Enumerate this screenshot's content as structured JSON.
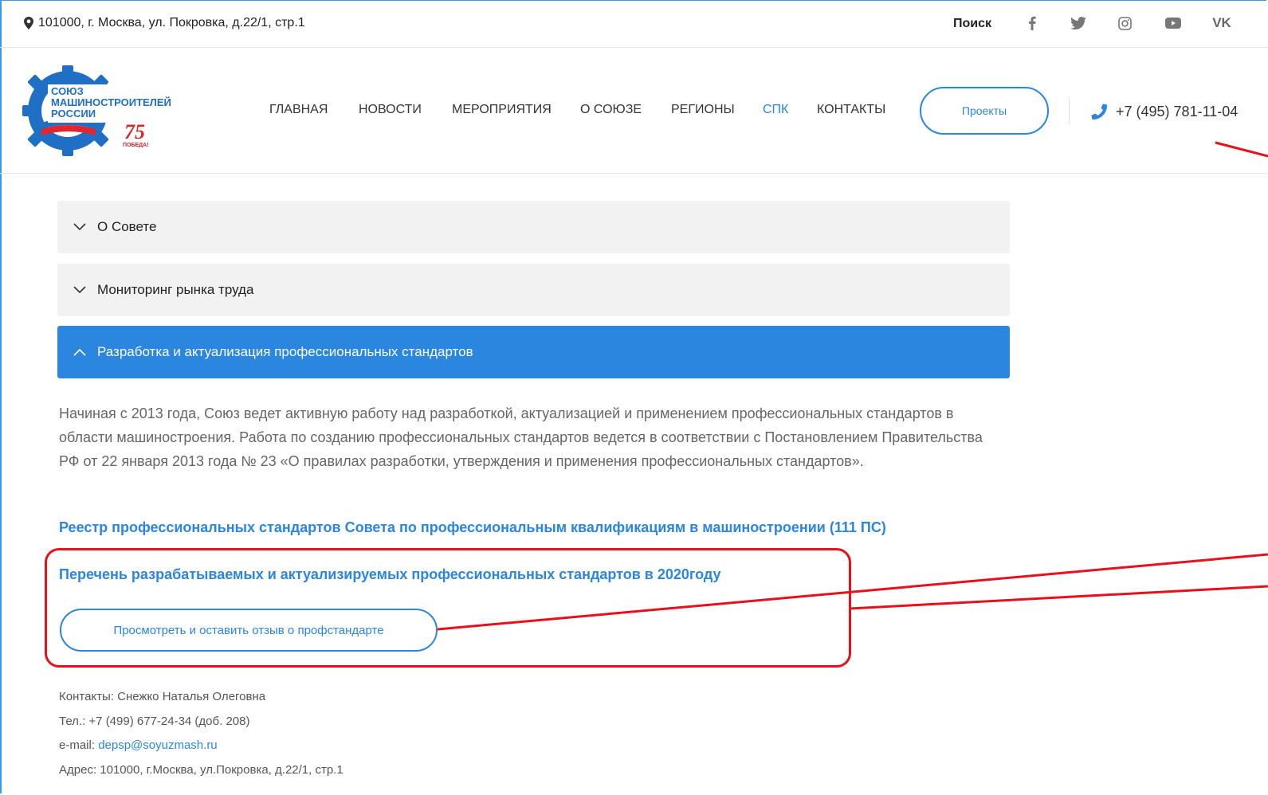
{
  "topbar": {
    "address": "101000, г. Москва, ул. Покровка, д.22/1, стр.1",
    "search": "Поиск",
    "social_icons": [
      "facebook-icon",
      "twitter-icon",
      "instagram-icon",
      "youtube-icon",
      "vk-icon"
    ],
    "vk_label": "VK"
  },
  "logo": {
    "line1": "СОЮЗ",
    "line2": "МАШИНОСТРОИТЕЛЕЙ",
    "line3": "РОССИИ",
    "badge_number": "75",
    "badge_word": "ПОБЕДА!"
  },
  "nav": {
    "items": [
      "ГЛАВНАЯ",
      "НОВОСТИ",
      "МЕРОПРИЯТИЯ",
      "О СОЮЗЕ",
      "РЕГИОНЫ",
      "СПК",
      "КОНТАКТЫ"
    ],
    "active": "СПК",
    "projects_button": "Проекты",
    "phone": "+7 (495) 781-11-04"
  },
  "accordion": [
    {
      "label": "О Совете",
      "open": false
    },
    {
      "label": "Мониторинг рынка труда",
      "open": false
    },
    {
      "label": "Разработка и актуализация профессиональных стандартов",
      "open": true
    }
  ],
  "content": {
    "paragraph": "Начиная с 2013 года, Союз ведет активную работу над разработкой, актуализацией и применением профессиональных стандартов в области машиностроения. Работа по созданию профессиональных стандартов ведется в соответствии с Постановлением Правительства РФ от 22 января 2013 года № 23 «О правилах разработки, утверждения и применения профессиональных стандартов».",
    "registry_link": "Реестр профессиональных стандартов Совета по профессиональным квалификациям в машиностроении (111 ПС)",
    "list_link": "Перечень разрабатываемых и актуализируемых профессиональных стандартов в 2020году",
    "review_button": "Просмотреть и оставить отзыв о профстандарте"
  },
  "contacts": {
    "person": "Контакты: Снежко Наталья Олеговна",
    "phone": "Тел.: +7 (499) 677-24-34 (доб. 208)",
    "email_label": "e-mail: ",
    "email": "depsp@soyuzmash.ru",
    "address": "Адрес: 101000, г.Москва, ул.Покровка, д.22/1, стр.1"
  },
  "colors": {
    "accent": "#2b86e0",
    "annotation": "#e8101b",
    "accordion_bg": "#f2f2f2"
  }
}
